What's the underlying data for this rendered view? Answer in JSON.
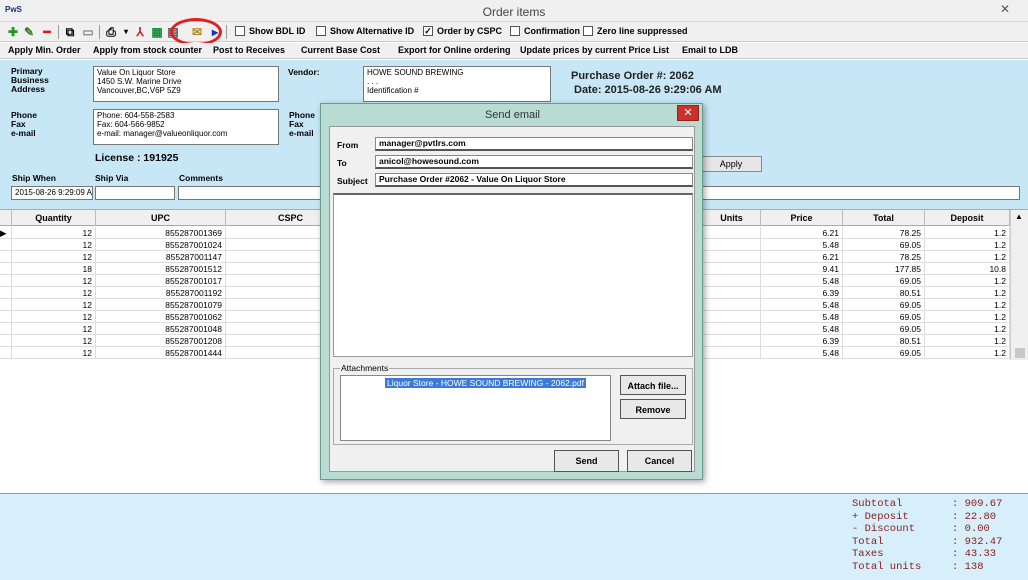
{
  "window": {
    "title": "Order items",
    "logo": "PwS"
  },
  "toolbar": {
    "checks": [
      {
        "label": "Show BDL ID",
        "checked": false
      },
      {
        "label": "Show Alternative ID",
        "checked": false
      },
      {
        "label": "Order by CSPC",
        "checked": true
      },
      {
        "label": "Confirmation",
        "checked": false
      },
      {
        "label": "Zero line suppressed",
        "checked": false
      }
    ]
  },
  "actions": [
    "Apply Min. Order",
    "Apply from stock counter",
    "Post to Receives",
    "Current Base Cost",
    "Export for Online ordering",
    "Update prices by current Price List",
    "Email to LDB"
  ],
  "header": {
    "address_label": "Primary\nBusiness\nAddress",
    "address_value": "Value On Liquor Store\n1450 S.W. Marine Drive\nVancouver,BC,V6P 5Z9",
    "contact_label": "Phone\nFax\ne-mail",
    "contact_value": "Phone: 604-558-2583\nFax: 604-566-9852\ne-mail: manager@valueonliquor.com",
    "license": "License :  191925",
    "vendor_label": "Vendor:",
    "vendor_value": "HOWE SOUND BREWING\n. . .\nIdentification #",
    "vendor_contact_label": "Phone\nFax\ne-mail",
    "po_number": "Purchase Order #: 2062",
    "po_date": "Date: 2015-08-26 9:29:06 AM",
    "ship_when_label": "Ship When",
    "ship_when_value": "2015-08-26 9:29:09 A",
    "ship_via_label": "Ship Via",
    "comments_label": "Comments",
    "apply_label": "Apply"
  },
  "grid": {
    "columns": [
      "Quantity",
      "UPC",
      "CSPC",
      "Units",
      "Price",
      "Total",
      "Deposit"
    ],
    "rows": [
      {
        "qty": "12",
        "upc": "855287001369",
        "price": "6.21",
        "total": "78.25",
        "deposit": "1.2"
      },
      {
        "qty": "12",
        "upc": "855287001024",
        "price": "5.48",
        "total": "69.05",
        "deposit": "1.2"
      },
      {
        "qty": "12",
        "upc": "855287001147",
        "price": "6.21",
        "total": "78.25",
        "deposit": "1.2"
      },
      {
        "qty": "18",
        "upc": "855287001512",
        "price": "9.41",
        "total": "177.85",
        "deposit": "10.8"
      },
      {
        "qty": "12",
        "upc": "855287001017",
        "price": "5.48",
        "total": "69.05",
        "deposit": "1.2"
      },
      {
        "qty": "12",
        "upc": "855287001192",
        "price": "6.39",
        "total": "80.51",
        "deposit": "1.2"
      },
      {
        "qty": "12",
        "upc": "855287001079",
        "price": "5.48",
        "total": "69.05",
        "deposit": "1.2"
      },
      {
        "qty": "12",
        "upc": "855287001062",
        "price": "5.48",
        "total": "69.05",
        "deposit": "1.2"
      },
      {
        "qty": "12",
        "upc": "855287001048",
        "price": "5.48",
        "total": "69.05",
        "deposit": "1.2"
      },
      {
        "qty": "12",
        "upc": "855287001208",
        "price": "6.39",
        "total": "80.51",
        "deposit": "1.2"
      },
      {
        "qty": "12",
        "upc": "855287001444",
        "price": "5.48",
        "total": "69.05",
        "deposit": "1.2"
      }
    ]
  },
  "summary": [
    {
      "label": "Subtotal",
      "value": ": 909.67"
    },
    {
      "label": "+ Deposit",
      "value": ": 22.80"
    },
    {
      "label": "- Discount",
      "value": ": 0.00"
    },
    {
      "label": "Total",
      "value": ": 932.47"
    },
    {
      "label": "Taxes",
      "value": ": 43.33"
    },
    {
      "label": "Total units",
      "value": ": 138"
    }
  ],
  "dialog": {
    "title": "Send email",
    "from_label": "From",
    "from_value": "manager@pvtlrs.com",
    "to_label": "To",
    "to_value": "anicol@howesound.com",
    "subject_label": "Subject",
    "subject_value": "Purchase Order #2062 - Value On Liquor Store",
    "attachments_label": "Attachments",
    "attachment_file": "Liquor Store - HOWE SOUND BREWING - 2062.pdf",
    "attach_button": "Attach file...",
    "remove_button": "Remove",
    "send_button": "Send",
    "cancel_button": "Cancel"
  },
  "colors": {
    "header_bg": "#c7e7f7",
    "dialog_bg": "#b8dcd2",
    "summary_text": "#8b1a1a",
    "highlight": "#e02020"
  }
}
